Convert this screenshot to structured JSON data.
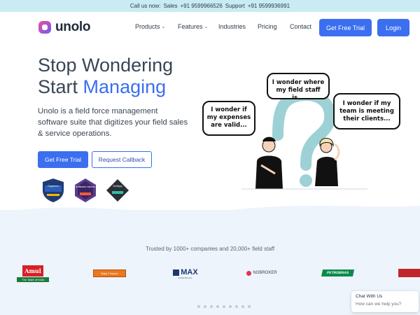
{
  "topbar": {
    "prefix": "Call us now:",
    "sales_label": "Sales",
    "sales_phone": "+91 9599966526",
    "support_label": "Support",
    "support_phone": "+91 9599936991"
  },
  "nav": {
    "brand": "unolo",
    "menu": [
      {
        "label": "Products",
        "has_dropdown": true
      },
      {
        "label": "Features",
        "has_dropdown": true
      },
      {
        "label": "Industries",
        "has_dropdown": false
      },
      {
        "label": "Pricing",
        "has_dropdown": false
      },
      {
        "label": "Contact",
        "has_dropdown": false
      }
    ],
    "cta_label": "Get Free Trial",
    "login_label": "Login"
  },
  "hero": {
    "title_line1": "Stop Wondering",
    "title_line2_start": "Start",
    "title_line2_accent": "Managing",
    "description": "Unolo is a field force management software suite that digitizes your field sales & service operations.",
    "primary_cta": "Get Free Trial",
    "secondary_cta": "Request Callback",
    "badges": [
      {
        "name": "Capterra"
      },
      {
        "name": "Software Advice"
      },
      {
        "name": "GetApp"
      }
    ]
  },
  "illustration": {
    "bubbles": [
      "I wonder if my expenses are valid...",
      "I wonder where my field staff is...",
      "I wonder if my team is meeting their clients..."
    ]
  },
  "trusted": {
    "text": "Trusted by 1000+ companies and 20,000+ field staff",
    "clients": [
      {
        "name": "Amul",
        "tagline": "The Taste of India"
      },
      {
        "name": "Bajaj Finance"
      },
      {
        "name": "MAX",
        "sub": "FINANCIAL"
      },
      {
        "name": "NOBROKER"
      },
      {
        "name": "PETROBRAS"
      },
      {
        "name": "Partner logo"
      }
    ]
  },
  "carousel": {
    "dot_count": 9
  },
  "chat": {
    "title": "Chat With Us",
    "subtitle": "How can we help you?"
  },
  "colors": {
    "accent": "#3b6ff0",
    "topbar_bg": "#c9ecf3",
    "section_bg": "#eef4fb",
    "question_mark": "#9ed1d5"
  }
}
